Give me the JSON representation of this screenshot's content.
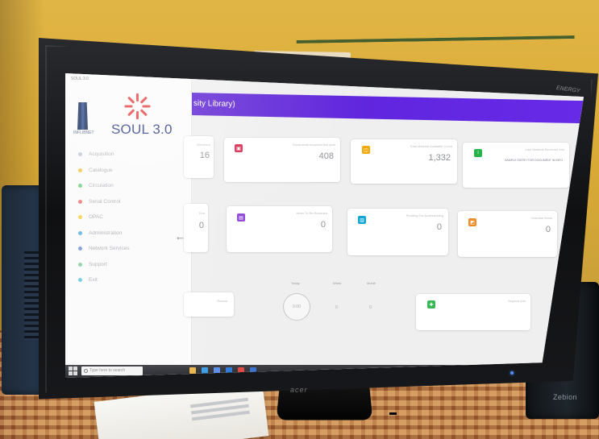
{
  "scene": {
    "colors": {
      "wall": "#dbab38",
      "bezel": "#17181b",
      "screen": "#f3f3f3",
      "header": "#6126df",
      "brand": "#2c3b83",
      "accent_red": "#e33e3f"
    },
    "monitor_logo": "acer",
    "corner_brand": "ENERGY",
    "speaker_brand": "Zebion"
  },
  "app": {
    "sidebar_caption": "SOUL 3.0",
    "logo_caption": "INFLIBNET",
    "brand": "SOUL 3.0",
    "header_title": "sity Library)",
    "back_arrow": "←",
    "nav_items": [
      {
        "label": "Acquisition",
        "color": "#aab3c2"
      },
      {
        "label": "Catalogue",
        "color": "#f0b100"
      },
      {
        "label": "Circulation",
        "color": "#3fbe58"
      },
      {
        "label": "Serial Control",
        "color": "#f04646"
      },
      {
        "label": "OPAC",
        "color": "#f0c800"
      },
      {
        "label": "Administration",
        "color": "#2d9bd8"
      },
      {
        "label": "Network Services",
        "color": "#5275c6"
      },
      {
        "label": "Support",
        "color": "#6bc08d"
      },
      {
        "label": "Exit",
        "color": "#3fbbd5"
      }
    ]
  },
  "dashboard": {
    "cards": [
      {
        "label": "Members",
        "value": "16",
        "icon": "users-icon",
        "color": "#dcdcdc"
      },
      {
        "label": "Documents Acquired this year",
        "value": "408",
        "icon": "document-icon",
        "color": "#d6254d"
      },
      {
        "label": "Total Material Available Count",
        "value": "1,332",
        "icon": "archive-icon",
        "color": "#f0a800"
      },
      {
        "label": "Last Material Received Info",
        "value": "",
        "text": "SAMPLE ENTRY FOR DOCUMENT IN INFO",
        "icon": "info-icon",
        "color": "#26b34a"
      },
      {
        "label": "Due",
        "value": "0",
        "icon": "clock-icon",
        "color": "#dcdcdc"
      },
      {
        "label": "Items To Be Returned",
        "value": "0",
        "icon": "return-icon",
        "color": "#8f45d6"
      },
      {
        "label": "Pending For Accessioning",
        "value": "0",
        "icon": "accession-icon",
        "color": "#0fa6d6"
      },
      {
        "label": "Overdue Items",
        "value": "0",
        "icon": "overdue-icon",
        "color": "#f08c29"
      }
    ],
    "stats": {
      "labels": [
        "Today",
        "Week",
        "Month"
      ],
      "circle_value": "0.00",
      "dots": [
        "0",
        "0"
      ]
    },
    "bottom_cards": [
      {
        "label": "Recent",
        "value": "",
        "icon": "notes-icon",
        "color": "#dcdcdc"
      },
      {
        "label": "Support Info",
        "value": "",
        "icon": "support-icon",
        "color": "#3ab755"
      }
    ]
  },
  "taskbar": {
    "search_placeholder": "Type here to search",
    "icons": [
      {
        "name": "explorer",
        "color": "#e8b548"
      },
      {
        "name": "edge",
        "color": "#3b9be2"
      },
      {
        "name": "store",
        "color": "#5b8def"
      },
      {
        "name": "mail",
        "color": "#2b78d6"
      },
      {
        "name": "chrome",
        "color": "#e1463f"
      },
      {
        "name": "word",
        "color": "#3772cf"
      }
    ]
  }
}
